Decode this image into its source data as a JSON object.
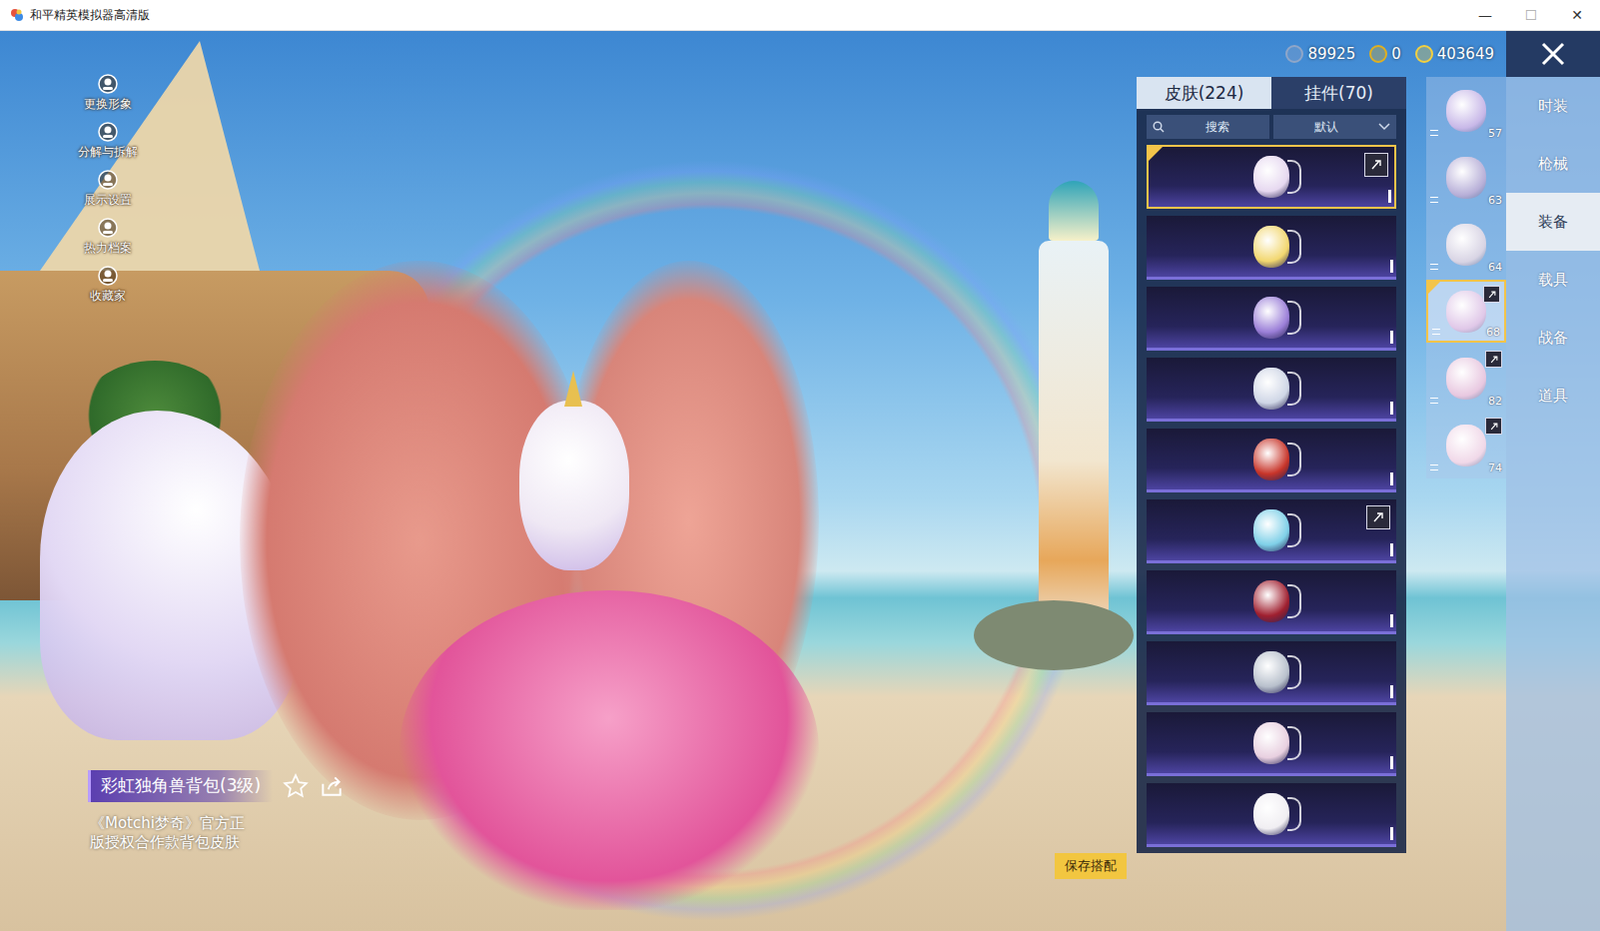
{
  "window": {
    "title": "和平精英模拟器高清版",
    "controls": [
      "—",
      "☐",
      "✕"
    ]
  },
  "side_menu": [
    {
      "label": "更换形象"
    },
    {
      "label": "分解与拆解"
    },
    {
      "label": "展示设置"
    },
    {
      "label": "热力档案"
    },
    {
      "label": "收藏家"
    }
  ],
  "item": {
    "name": "彩虹独角兽背包(3级)",
    "description_lines": [
      "《Motchi梦奇》官方正",
      "版授权合作款背包皮肤"
    ]
  },
  "currencies": [
    {
      "value": "89925",
      "color": "#8fa6c8"
    },
    {
      "value": "0",
      "color": "#e0b020"
    },
    {
      "value": "403649",
      "color": "#f2d040"
    }
  ],
  "tabs": [
    {
      "label": "皮肤(224)",
      "selected": true
    },
    {
      "label": "挂件(70)",
      "selected": false
    }
  ],
  "search": {
    "placeholder": "搜索"
  },
  "sort": {
    "value": "默认"
  },
  "skins": [
    {
      "selected": true,
      "badge": true,
      "color": "#e6d8f0"
    },
    {
      "selected": false,
      "badge": false,
      "color": "#f2d770"
    },
    {
      "selected": false,
      "badge": false,
      "color": "#9b7fd8"
    },
    {
      "selected": false,
      "badge": false,
      "color": "#cfd6e6"
    },
    {
      "selected": false,
      "badge": false,
      "color": "#c8352a"
    },
    {
      "selected": false,
      "badge": true,
      "color": "#7fd0e8"
    },
    {
      "selected": false,
      "badge": false,
      "color": "#a02030"
    },
    {
      "selected": false,
      "badge": false,
      "color": "#b8c0cc"
    },
    {
      "selected": false,
      "badge": false,
      "color": "#e8d0e0"
    },
    {
      "selected": false,
      "badge": false,
      "color": "#f0eef2"
    }
  ],
  "save_button": "保存搭配",
  "levels": [
    {
      "level": "57",
      "selected": false,
      "badge": false,
      "color": "#c8b8e8"
    },
    {
      "level": "63",
      "selected": false,
      "badge": false,
      "color": "#b8b0d8"
    },
    {
      "level": "64",
      "selected": false,
      "badge": false,
      "color": "#d8d4e4"
    },
    {
      "level": "68",
      "selected": true,
      "badge": true,
      "color": "#e0c8e8"
    },
    {
      "level": "82",
      "selected": false,
      "badge": true,
      "color": "#e8c8e0"
    },
    {
      "level": "74",
      "selected": false,
      "badge": true,
      "color": "#f0d8e8"
    }
  ],
  "categories": [
    {
      "label": "时装",
      "selected": false
    },
    {
      "label": "枪械",
      "selected": false
    },
    {
      "label": "装备",
      "selected": true
    },
    {
      "label": "载具",
      "selected": false
    },
    {
      "label": "战备",
      "selected": false
    },
    {
      "label": "道具",
      "selected": false
    }
  ]
}
